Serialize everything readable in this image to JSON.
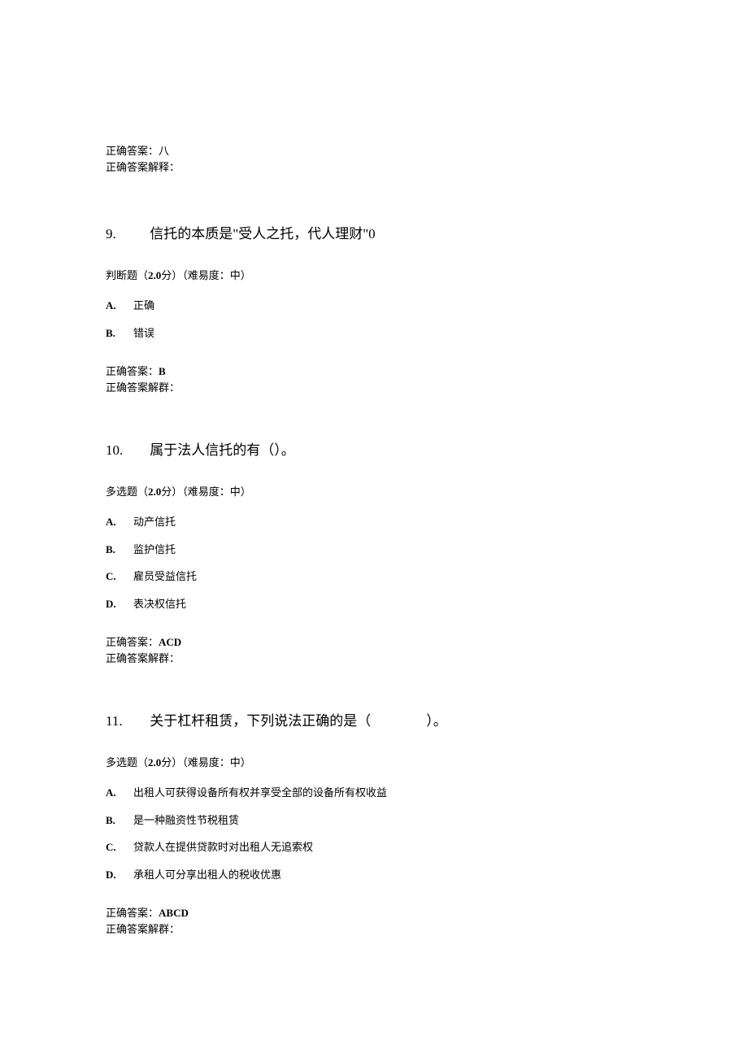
{
  "prevAnswer": {
    "answerLabel": "正确答案：",
    "answerValue": "八",
    "explanationLabel": "正确答案解释："
  },
  "questions": [
    {
      "number": "9.",
      "title": "信托的本质是\"受人之托，代人理财\"0",
      "typeLabel": "判断题（",
      "points": "2.0",
      "pointsAfter": "分）（难易度：中）",
      "options": [
        {
          "letter": "A.",
          "text": "正确"
        },
        {
          "letter": "B.",
          "text": "错误"
        }
      ],
      "answerLabel": "正确答案：",
      "answerValue": "B",
      "explanationLabel": "正确答案解群："
    },
    {
      "number": "10.",
      "title": "属于法人信托的有（）。",
      "typeLabel": "多选题（",
      "points": "2.0",
      "pointsAfter": "分）（难易度：中）",
      "options": [
        {
          "letter": "A.",
          "text": "动产信托"
        },
        {
          "letter": "B.",
          "text": "监护信托"
        },
        {
          "letter": "C.",
          "text": "雇员受益信托"
        },
        {
          "letter": "D.",
          "text": "表决权信托"
        }
      ],
      "answerLabel": "正确答案：",
      "answerValue": "ACD",
      "explanationLabel": "正确答案解群："
    },
    {
      "number": "11.",
      "title": "关于杠杆租赁，下列说法正确的是（　　　　）。",
      "typeLabel": "多选题（",
      "points": "2.0",
      "pointsAfter": "分）（难易度：中）",
      "options": [
        {
          "letter": "A.",
          "text": "出租人可获得设备所有权并享受全部的设备所有权收益"
        },
        {
          "letter": "B.",
          "text": "是一种融资性节税租赁"
        },
        {
          "letter": "C.",
          "text": "贷款人在提供贷款时对出租人无追索权"
        },
        {
          "letter": "D.",
          "text": "承租人可分享出租人的税收优惠"
        }
      ],
      "answerLabel": "正确答案：",
      "answerValue": "ABCD",
      "explanationLabel": "正确答案解群："
    }
  ]
}
